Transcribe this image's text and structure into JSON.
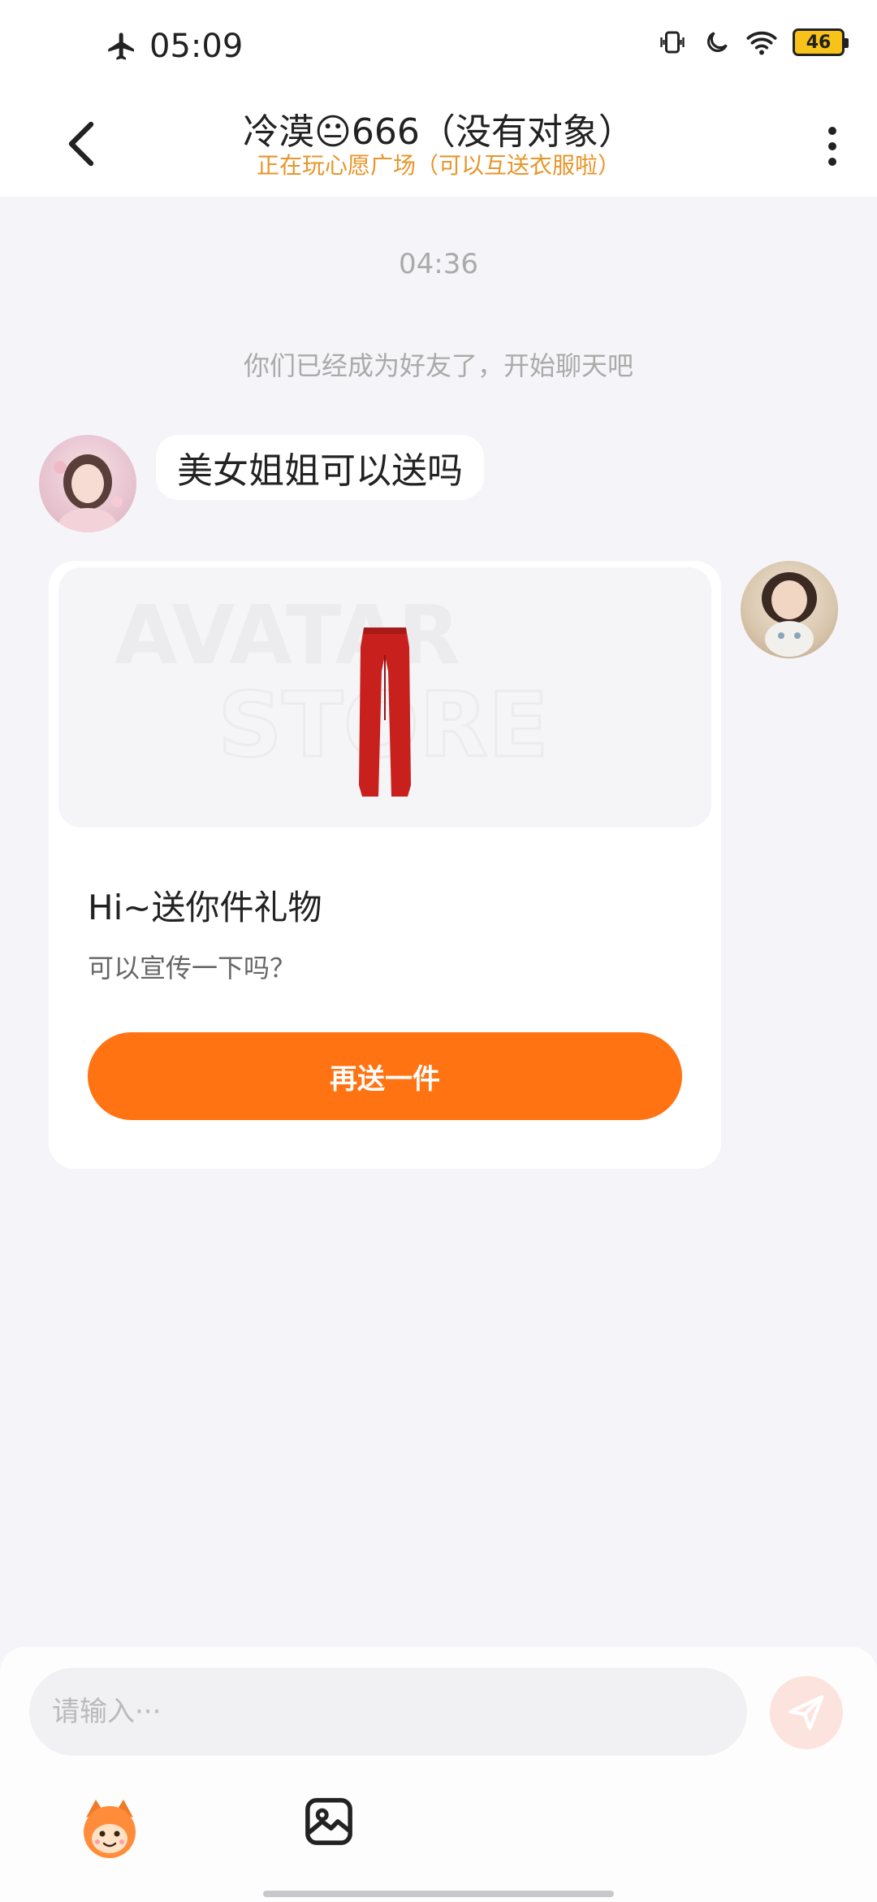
{
  "status_bar": {
    "time": "05:09",
    "battery": "46"
  },
  "header": {
    "title": "冷漠😐666（没有对象）",
    "subtitle": "正在玩心愿广场（可以互送衣服啦）"
  },
  "chat": {
    "time_divider": "04:36",
    "system_message": "你们已经成为好友了，开始聊天吧",
    "incoming_message": "美女姐姐可以送吗",
    "gift_card": {
      "watermark_line1": "AVATAR",
      "watermark_line2": "STORE",
      "title": "Hi~送你件礼物",
      "description": "可以宣传一下吗？",
      "button_label": "再送一件",
      "item_color": "#c8211d"
    }
  },
  "input": {
    "placeholder": "请输入···"
  },
  "colors": {
    "accent": "#ff7313",
    "subtitle": "#e8952a"
  },
  "icons": {
    "back": "chevron-left-icon",
    "more": "more-vertical-icon",
    "send": "send-icon",
    "emoji": "emoji-mascot-icon",
    "image": "image-icon",
    "airplane": "airplane-icon",
    "vibrate": "vibrate-icon",
    "moon": "moon-icon",
    "wifi": "wifi-icon"
  }
}
